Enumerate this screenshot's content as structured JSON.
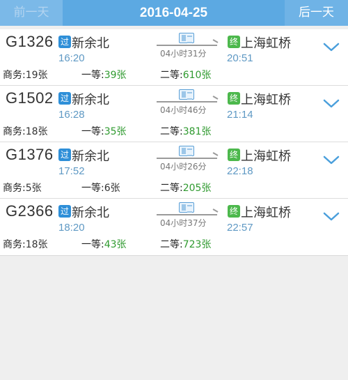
{
  "header": {
    "prev_label": "前一天",
    "date": "2016-04-25",
    "next_label": "后一天"
  },
  "colors": {
    "header_bg": "#5ca9e2",
    "available": "#2f9a2f",
    "time": "#5f99c4",
    "pass_badge": "#2e8fd8",
    "end_badge": "#4cb84c"
  },
  "trains": [
    {
      "number": "G1326",
      "pass_badge": "过",
      "from": "新余北",
      "depart": "16:20",
      "duration": "04小时31分",
      "end_badge": "终",
      "to": "上海虹桥",
      "arrive": "20:51",
      "seats": [
        {
          "label": "商务:",
          "count": "19张",
          "available": false
        },
        {
          "label": "一等:",
          "count": "39张",
          "available": true
        },
        {
          "label": "二等:",
          "count": "610张",
          "available": true
        }
      ]
    },
    {
      "number": "G1502",
      "pass_badge": "过",
      "from": "新余北",
      "depart": "16:28",
      "duration": "04小时46分",
      "end_badge": "终",
      "to": "上海虹桥",
      "arrive": "21:14",
      "seats": [
        {
          "label": "商务:",
          "count": "18张",
          "available": false
        },
        {
          "label": "一等:",
          "count": "35张",
          "available": true
        },
        {
          "label": "二等:",
          "count": "381张",
          "available": true
        }
      ]
    },
    {
      "number": "G1376",
      "pass_badge": "过",
      "from": "新余北",
      "depart": "17:52",
      "duration": "04小时26分",
      "end_badge": "终",
      "to": "上海虹桥",
      "arrive": "22:18",
      "seats": [
        {
          "label": "商务:",
          "count": "5张",
          "available": false
        },
        {
          "label": "一等:",
          "count": "6张",
          "available": false
        },
        {
          "label": "二等:",
          "count": "205张",
          "available": true
        }
      ]
    },
    {
      "number": "G2366",
      "pass_badge": "过",
      "from": "新余北",
      "depart": "18:20",
      "duration": "04小时37分",
      "end_badge": "终",
      "to": "上海虹桥",
      "arrive": "22:57",
      "seats": [
        {
          "label": "商务:",
          "count": "18张",
          "available": false
        },
        {
          "label": "一等:",
          "count": "43张",
          "available": true
        },
        {
          "label": "二等:",
          "count": "723张",
          "available": true
        }
      ]
    }
  ]
}
